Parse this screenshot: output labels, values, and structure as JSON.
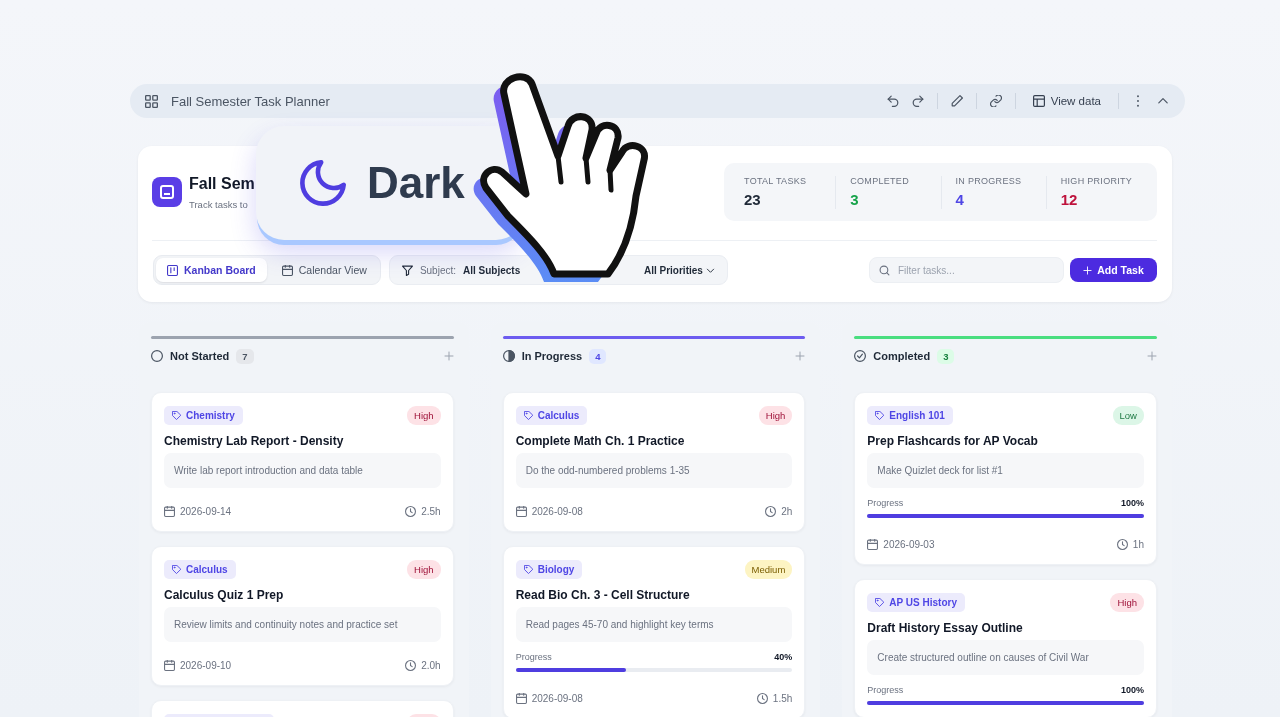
{
  "toolbar": {
    "title": "Fall Semester Task Planner",
    "view_button": "View data"
  },
  "header": {
    "title": "Fall Sem",
    "subtitle": "Track tasks to"
  },
  "theme_popup": {
    "label": "Dark"
  },
  "stats": [
    {
      "label": "TOTAL TASKS",
      "value": "23",
      "color": "#1f2937"
    },
    {
      "label": "COMPLETED",
      "value": "3",
      "color": "#16a34a"
    },
    {
      "label": "IN PROGRESS",
      "value": "4",
      "color": "#4f46e5"
    },
    {
      "label": "HIGH PRIORITY",
      "value": "12",
      "color": "#be123c"
    }
  ],
  "view_tabs": [
    {
      "label": "Kanban Board",
      "selected": true
    },
    {
      "label": "Calendar View",
      "selected": false
    }
  ],
  "filters": {
    "subject_label": "Subject:",
    "subject_value": "All Subjects",
    "priority_value": "All Priorities"
  },
  "search": {
    "placeholder": "Filter tasks..."
  },
  "add_button": "Add Task",
  "columns": [
    {
      "title": "Not Started",
      "count": "7",
      "kind": "not_started",
      "color": "#9ca3af",
      "cards": [
        {
          "kind": "task",
          "tag": "Chemistry",
          "priority": {
            "label": "High",
            "kind": "high"
          },
          "title": "Chemistry Lab Report - Density",
          "description": "Write lab report introduction and data table",
          "date": "2026-09-14",
          "hours": "2.5h"
        },
        {
          "kind": "task",
          "tag": "Calculus",
          "priority": {
            "label": "High",
            "kind": "high"
          },
          "title": "Calculus Quiz 1 Prep",
          "description": "Review limits and continuity notes and practice set",
          "date": "2026-09-10",
          "hours": "2.0h"
        },
        {
          "kind": "cut",
          "priority": {
            "kind": "high"
          }
        }
      ]
    },
    {
      "title": "In Progress",
      "count": "4",
      "kind": "in_progress",
      "color": "#6d5cf0",
      "cards": [
        {
          "kind": "task",
          "tag": "Calculus",
          "priority": {
            "label": "High",
            "kind": "high"
          },
          "title": "Complete Math Ch. 1 Practice",
          "description": "Do the odd-numbered problems 1-35",
          "date": "2026-09-08",
          "hours": "2h"
        },
        {
          "kind": "task",
          "tag": "Biology",
          "priority": {
            "label": "Medium",
            "kind": "medium"
          },
          "title": "Read Bio Ch. 3 - Cell Structure",
          "description": "Read pages 45-70 and highlight key terms",
          "progress": {
            "label": "Progress",
            "value": "40%",
            "level": 0.4
          },
          "date": "2026-09-08",
          "hours": "1.5h"
        }
      ]
    },
    {
      "title": "Completed",
      "count": "3",
      "kind": "completed",
      "color": "#4ade80",
      "cards": [
        {
          "kind": "task",
          "tag": "English 101",
          "priority": {
            "label": "Low",
            "kind": "low"
          },
          "title": "Prep Flashcards for AP Vocab",
          "description": "Make Quizlet deck for list #1",
          "progress": {
            "label": "Progress",
            "value": "100%",
            "level": 1
          },
          "date": "2026-09-03",
          "hours": "1h"
        },
        {
          "kind": "task",
          "tag": "AP US History",
          "priority": {
            "label": "High",
            "kind": "high"
          },
          "title": "Draft History Essay Outline",
          "description": "Create structured outline on causes of Civil War",
          "progress": {
            "label": "Progress",
            "value": "100%",
            "level": 1
          }
        }
      ]
    }
  ]
}
